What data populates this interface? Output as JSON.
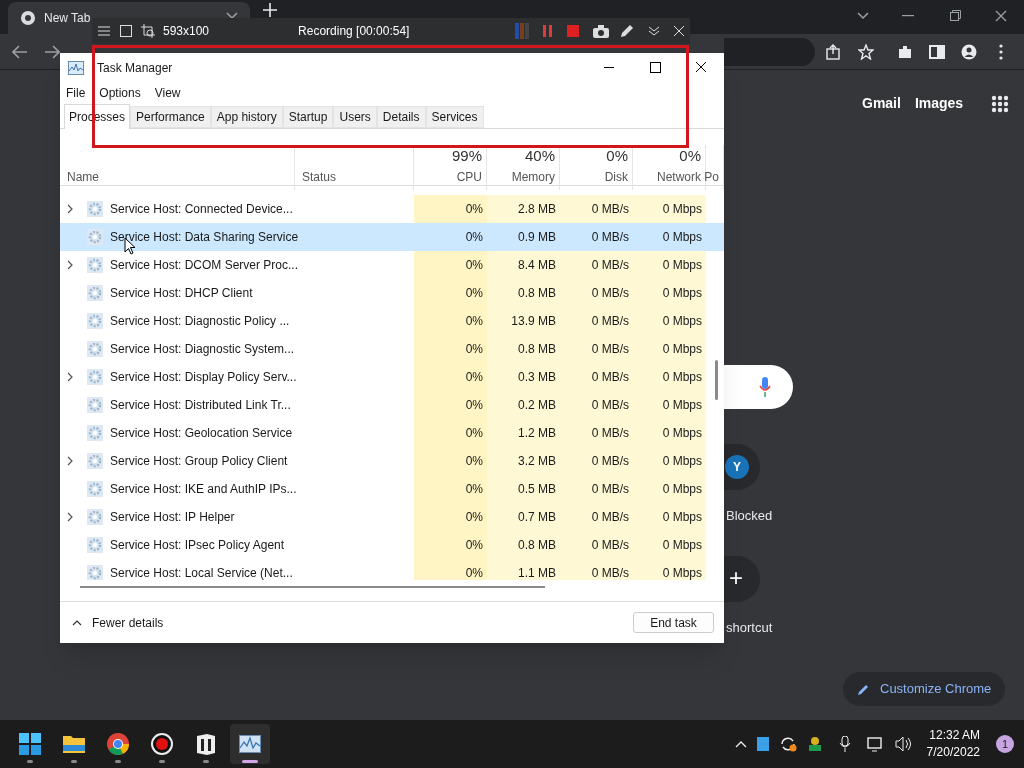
{
  "browser": {
    "tab": {
      "title": "New Tab"
    },
    "links": [
      "Gmail",
      "Images"
    ],
    "shortcuts": [
      {
        "kind": "letter",
        "icon_text": "Y",
        "label": "Blocked"
      },
      {
        "kind": "add",
        "icon_text": "+",
        "label": "shortcut"
      }
    ],
    "customize_button": "Customize Chrome"
  },
  "recorder": {
    "size": "593x100",
    "status": "Recording [00:00:54]"
  },
  "task_manager": {
    "title": "Task Manager",
    "menu": [
      "File",
      "Options",
      "View"
    ],
    "tabs": [
      {
        "label": "Processes",
        "selected": true
      },
      {
        "label": "Performance",
        "selected": false
      },
      {
        "label": "App history",
        "selected": false
      },
      {
        "label": "Startup",
        "selected": false
      },
      {
        "label": "Users",
        "selected": false
      },
      {
        "label": "Details",
        "selected": false
      },
      {
        "label": "Services",
        "selected": false
      }
    ],
    "columns": [
      {
        "label": "Name"
      },
      {
        "label": "Status"
      },
      {
        "label": "CPU",
        "usage": "99%"
      },
      {
        "label": "Memory",
        "usage": "40%"
      },
      {
        "label": "Disk",
        "usage": "0%"
      },
      {
        "label": "Network",
        "usage": "0%"
      },
      {
        "label": "Po"
      }
    ],
    "rows": [
      {
        "name": "Service Host: Connected Device...",
        "expandable": true,
        "selected": false,
        "cpu": "0%",
        "memory": "2.8 MB",
        "disk": "0 MB/s",
        "network": "0 Mbps"
      },
      {
        "name": "Service Host: Data Sharing Service",
        "expandable": false,
        "selected": true,
        "cpu": "0%",
        "memory": "0.9 MB",
        "disk": "0 MB/s",
        "network": "0 Mbps"
      },
      {
        "name": "Service Host: DCOM Server Proc...",
        "expandable": true,
        "selected": false,
        "cpu": "0%",
        "memory": "8.4 MB",
        "disk": "0 MB/s",
        "network": "0 Mbps"
      },
      {
        "name": "Service Host: DHCP Client",
        "expandable": false,
        "selected": false,
        "cpu": "0%",
        "memory": "0.8 MB",
        "disk": "0 MB/s",
        "network": "0 Mbps"
      },
      {
        "name": "Service Host: Diagnostic Policy ...",
        "expandable": false,
        "selected": false,
        "cpu": "0%",
        "memory": "13.9 MB",
        "disk": "0 MB/s",
        "network": "0 Mbps"
      },
      {
        "name": "Service Host: Diagnostic System...",
        "expandable": false,
        "selected": false,
        "cpu": "0%",
        "memory": "0.8 MB",
        "disk": "0 MB/s",
        "network": "0 Mbps"
      },
      {
        "name": "Service Host: Display Policy Serv...",
        "expandable": true,
        "selected": false,
        "cpu": "0%",
        "memory": "0.3 MB",
        "disk": "0 MB/s",
        "network": "0 Mbps"
      },
      {
        "name": "Service Host: Distributed Link Tr...",
        "expandable": false,
        "selected": false,
        "cpu": "0%",
        "memory": "0.2 MB",
        "disk": "0 MB/s",
        "network": "0 Mbps"
      },
      {
        "name": "Service Host: Geolocation Service",
        "expandable": false,
        "selected": false,
        "cpu": "0%",
        "memory": "1.2 MB",
        "disk": "0 MB/s",
        "network": "0 Mbps"
      },
      {
        "name": "Service Host: Group Policy Client",
        "expandable": true,
        "selected": false,
        "cpu": "0%",
        "memory": "3.2 MB",
        "disk": "0 MB/s",
        "network": "0 Mbps"
      },
      {
        "name": "Service Host: IKE and AuthIP IPs...",
        "expandable": false,
        "selected": false,
        "cpu": "0%",
        "memory": "0.5 MB",
        "disk": "0 MB/s",
        "network": "0 Mbps"
      },
      {
        "name": "Service Host: IP Helper",
        "expandable": true,
        "selected": false,
        "cpu": "0%",
        "memory": "0.7 MB",
        "disk": "0 MB/s",
        "network": "0 Mbps"
      },
      {
        "name": "Service Host: IPsec Policy Agent",
        "expandable": false,
        "selected": false,
        "cpu": "0%",
        "memory": "0.8 MB",
        "disk": "0 MB/s",
        "network": "0 Mbps"
      },
      {
        "name": "Service Host: Local Service (Net...",
        "expandable": false,
        "selected": false,
        "cpu": "0%",
        "memory": "1.1 MB",
        "disk": "0 MB/s",
        "network": "0 Mbps"
      }
    ],
    "fewer_details": "Fewer details",
    "end_task": "End task"
  },
  "taskbar": {
    "apps": [
      {
        "kind": "windows",
        "active": false
      },
      {
        "kind": "folder",
        "active": false
      },
      {
        "kind": "chrome",
        "active": false
      },
      {
        "kind": "record",
        "active": false
      },
      {
        "kind": "app",
        "active": false
      },
      {
        "kind": "taskmgr",
        "active": true
      }
    ],
    "time": "12:32 AM",
    "date": "7/20/2022",
    "notifications": "1"
  }
}
